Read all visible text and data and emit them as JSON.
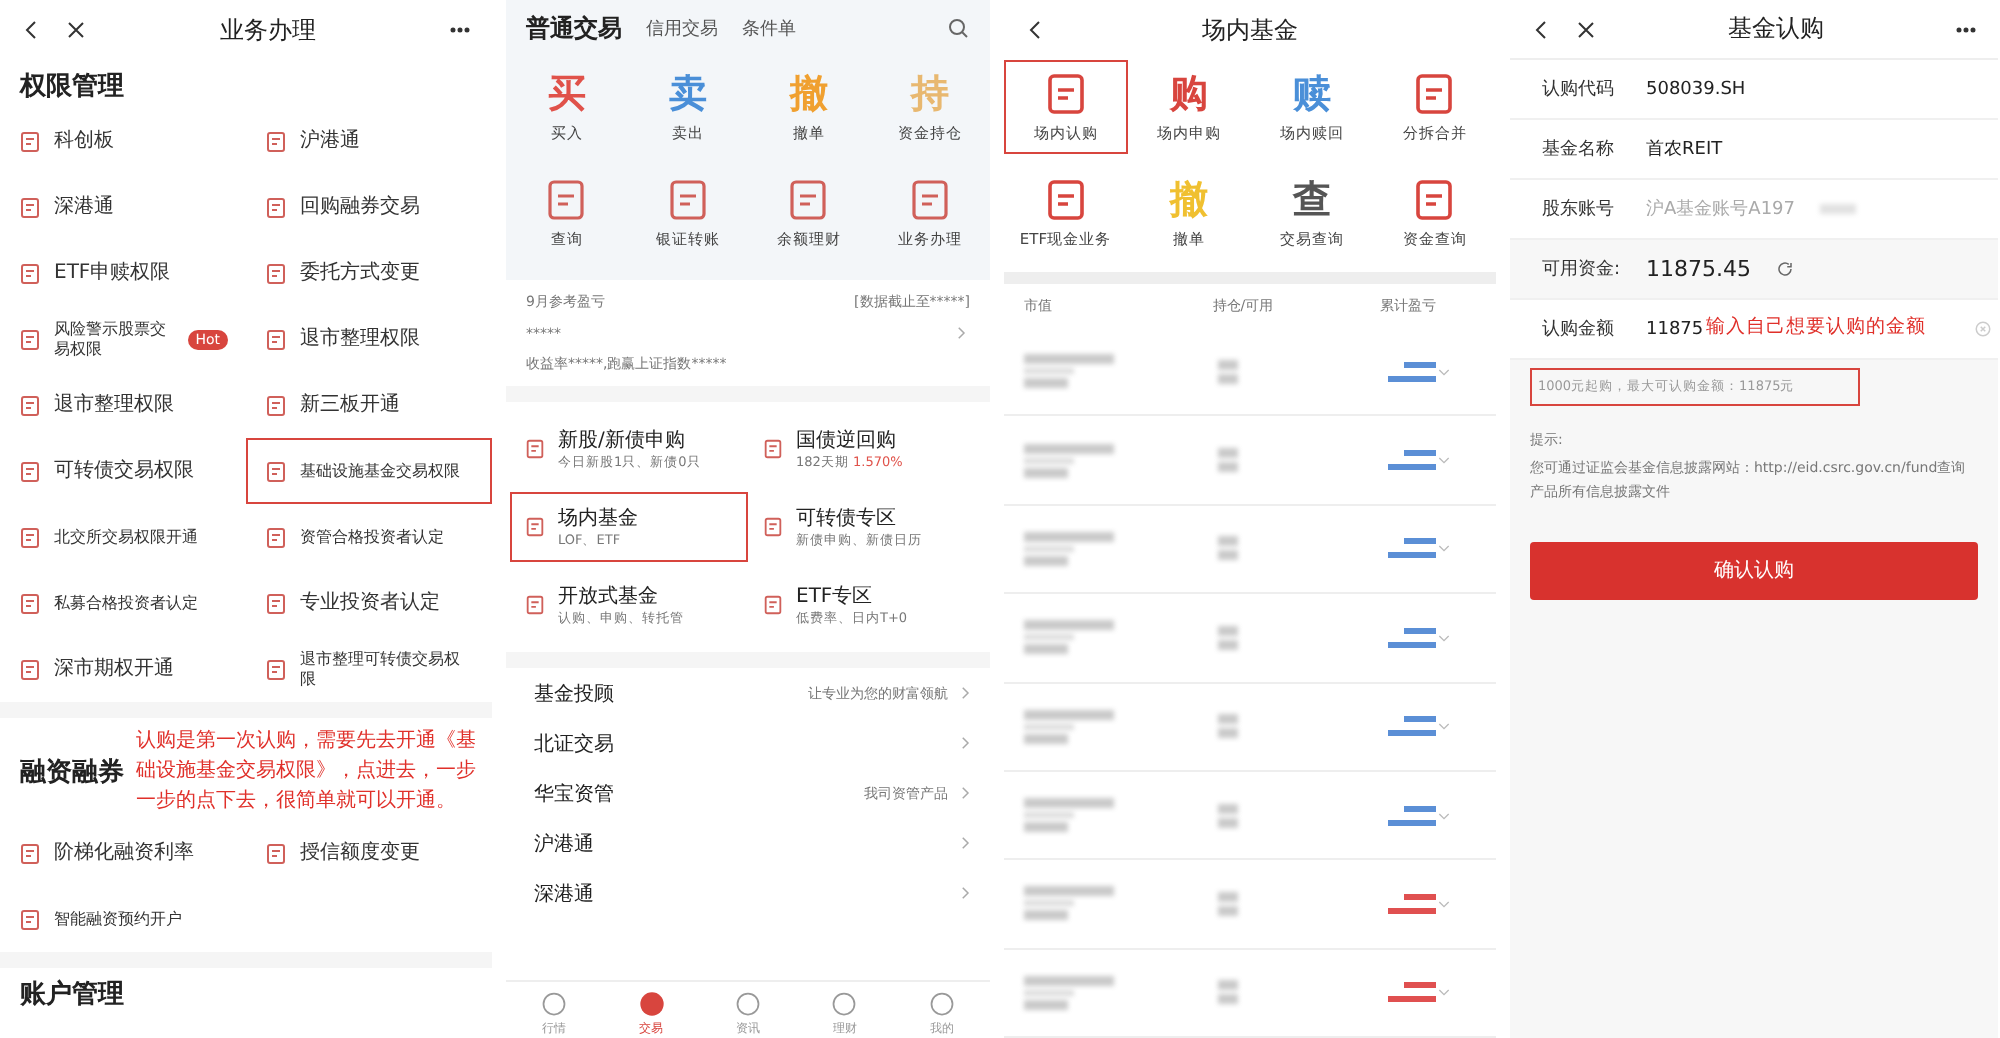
{
  "panel_1": {
    "title": "业务办理",
    "sections": [
      {
        "title": "权限管理",
        "items": [
          {
            "label": "科创板",
            "highlighted": false
          },
          {
            "label": "沪港通",
            "highlighted": false
          },
          {
            "label": "深港通",
            "highlighted": false
          },
          {
            "label": "回购融券交易",
            "highlighted": false
          },
          {
            "label": "ETF申赎权限",
            "highlighted": false
          },
          {
            "label": "委托方式变更",
            "highlighted": false
          },
          {
            "label": "风险警示股票交易权限",
            "badge": "Hot",
            "highlighted": false
          },
          {
            "label": "退市整理权限",
            "highlighted": false
          },
          {
            "label": "退市整理权限",
            "highlighted": false
          },
          {
            "label": "新三板开通",
            "highlighted": false
          },
          {
            "label": "可转债交易权限",
            "highlighted": false
          },
          {
            "label": "基础设施基金交易权限",
            "highlighted": true
          },
          {
            "label": "北交所交易权限开通",
            "highlighted": false
          },
          {
            "label": "资管合格投资者认定",
            "highlighted": false
          },
          {
            "label": "私募合格投资者认定",
            "highlighted": false
          },
          {
            "label": "专业投资者认定",
            "highlighted": false
          },
          {
            "label": "深市期权开通",
            "highlighted": false
          },
          {
            "label": "退市整理可转债交易权限",
            "highlighted": false
          }
        ]
      },
      {
        "title": "融资融券",
        "items": [
          {
            "label": "阶梯化融资利率",
            "highlighted": false
          },
          {
            "label": "授信额度变更",
            "highlighted": false
          },
          {
            "label": "智能融资预约开户",
            "highlighted": false
          }
        ]
      },
      {
        "title": "账户管理"
      }
    ],
    "annotation": "认购是第一次认购，需要先去开通《基础设施基金交易权限》，点进去，一步一步的点下去，很简单就可以开通。"
  },
  "panel_2": {
    "tabs": [
      {
        "label": "普通交易",
        "selected": true
      },
      {
        "label": "信用交易",
        "selected": false
      },
      {
        "label": "条件单",
        "selected": false
      }
    ],
    "actions": [
      {
        "kind": "glyph",
        "glyph": "买",
        "label": "买入",
        "color": "#e0524a"
      },
      {
        "kind": "glyph",
        "glyph": "卖",
        "label": "卖出",
        "color": "#4a8fd8"
      },
      {
        "kind": "glyph",
        "glyph": "撤",
        "label": "撤单",
        "color": "#f0a030"
      },
      {
        "kind": "glyph",
        "glyph": "持",
        "label": "资金持仓",
        "color": "#e8b870"
      },
      {
        "kind": "icon",
        "label": "查询",
        "color": "#d0605a"
      },
      {
        "kind": "icon",
        "label": "银证转账",
        "color": "#d0605a"
      },
      {
        "kind": "icon",
        "label": "余额理财",
        "color": "#d0605a"
      },
      {
        "kind": "icon",
        "label": "业务办理",
        "color": "#d0605a"
      }
    ],
    "summary": {
      "month": "9月参考盈亏",
      "note": "[数据截止至*****]",
      "amount": "*****",
      "detail": "收益率*****,跑赢上证指数*****"
    },
    "cards": [
      {
        "title": "新股/新债申购",
        "subtitle": "今日新股1只、新债0只",
        "highlighted": false
      },
      {
        "title": "国债逆回购",
        "subtitle": "182天期",
        "extra": "1.570%",
        "highlighted": false
      },
      {
        "title": "场内基金",
        "subtitle": "LOF、ETF",
        "highlighted": true
      },
      {
        "title": "可转债专区",
        "subtitle": "新债申购、新债日历",
        "highlighted": false
      },
      {
        "title": "开放式基金",
        "subtitle": "认购、申购、转托管",
        "highlighted": false
      },
      {
        "title": "ETF专区",
        "subtitle": "低费率、日内T+0",
        "highlighted": false
      }
    ],
    "links": [
      {
        "label": "基金投顾",
        "hint": "让专业为您的财富领航"
      },
      {
        "label": "北证交易"
      },
      {
        "label": "华宝资管",
        "hint": "我司资管产品"
      },
      {
        "label": "沪港通"
      },
      {
        "label": "深港通"
      }
    ],
    "nav": [
      {
        "label": "行情",
        "selected": false
      },
      {
        "label": "交易",
        "selected": true
      },
      {
        "label": "资讯",
        "selected": false
      },
      {
        "label": "理财",
        "selected": false
      },
      {
        "label": "我的",
        "selected": false
      }
    ]
  },
  "panel_3": {
    "title": "场内基金",
    "actions": [
      {
        "kind": "icon",
        "label": "场内认购",
        "color": "#d8453e",
        "highlighted": true
      },
      {
        "kind": "glyph",
        "glyph": "购",
        "label": "场内申购",
        "color": "#d8453e",
        "highlighted": false
      },
      {
        "kind": "glyph",
        "glyph": "赎",
        "label": "场内赎回",
        "color": "#4a8fd8",
        "highlighted": false
      },
      {
        "kind": "icon",
        "label": "分拆合并",
        "color": "#d8453e",
        "highlighted": false
      },
      {
        "kind": "icon",
        "label": "ETF现金业务",
        "color": "#d8453e",
        "highlighted": false
      },
      {
        "kind": "glyph",
        "glyph": "撤",
        "label": "撤单",
        "color": "#f0c030",
        "highlighted": false
      },
      {
        "kind": "glyph",
        "glyph": "查",
        "label": "交易查询",
        "color": "#555555",
        "highlighted": false
      },
      {
        "kind": "icon",
        "label": "资金查询",
        "color": "#d8453e",
        "highlighted": false
      }
    ],
    "columns": [
      "市值",
      "持仓/可用",
      "累计盈亏"
    ],
    "rows": [
      {
        "color": "#5b8fd6"
      },
      {
        "color": "#5b8fd6"
      },
      {
        "color": "#5b8fd6"
      },
      {
        "color": "#5b8fd6"
      },
      {
        "color": "#5b8fd6"
      },
      {
        "color": "#5b8fd6"
      },
      {
        "color": "#e05050"
      },
      {
        "color": "#e05050"
      }
    ]
  },
  "panel_4": {
    "title": "基金认购",
    "fields": [
      {
        "kind": "text",
        "label": "认购代码",
        "value": "508039.SH"
      },
      {
        "kind": "text",
        "label": "基金名称",
        "value": "首农REIT"
      },
      {
        "kind": "masked",
        "label": "股东账号",
        "value": "沪A基金账号A197"
      },
      {
        "kind": "balance",
        "label": "可用资金:",
        "value": "11875.45"
      },
      {
        "kind": "input",
        "label": "认购金额",
        "value": "11875"
      }
    ],
    "annotation": "输入自己想要认购的金额",
    "limit": "1000元起购，最大可认购金额：11875元",
    "tip_title": "提示:",
    "tip": "您可通过证监会基金信息披露网站：http://eid.csrc.gov.cn/fund查询产品所有信息披露文件",
    "button": "确认认购"
  }
}
